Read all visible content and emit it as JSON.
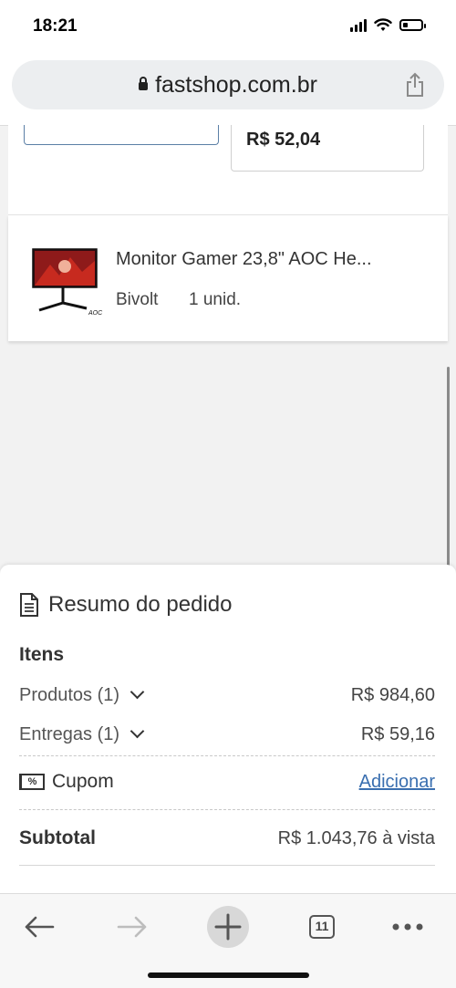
{
  "status_bar": {
    "time": "18:21",
    "battery_level": 0.3
  },
  "browser": {
    "url": "fastshop.com.br",
    "tabs_count": "11"
  },
  "order": {
    "shipping_price": "R$ 52,04",
    "product": {
      "name": "Monitor Gamer 23,8\" AOC He...",
      "variant": "Bivolt",
      "quantity": "1 unid."
    }
  },
  "summary": {
    "title": "Resumo do pedido",
    "items_heading": "Itens",
    "products_label": "Produtos (1)",
    "products_value": "R$ 984,60",
    "deliveries_label": "Entregas (1)",
    "deliveries_value": "R$ 59,16",
    "coupon_label": "Cupom",
    "coupon_icon_text": "%",
    "coupon_action": "Adicionar",
    "subtotal_label": "Subtotal",
    "subtotal_value": "R$ 1.043,76 à vista"
  },
  "colors": {
    "link": "#3a6fb0",
    "background": "#f2f2f2"
  },
  "icons": [
    "lock-icon",
    "share-icon",
    "document-icon",
    "chevron-down-icon",
    "coupon-icon",
    "back-arrow-icon",
    "forward-arrow-icon",
    "plus-icon",
    "tabs-icon",
    "more-icon"
  ]
}
